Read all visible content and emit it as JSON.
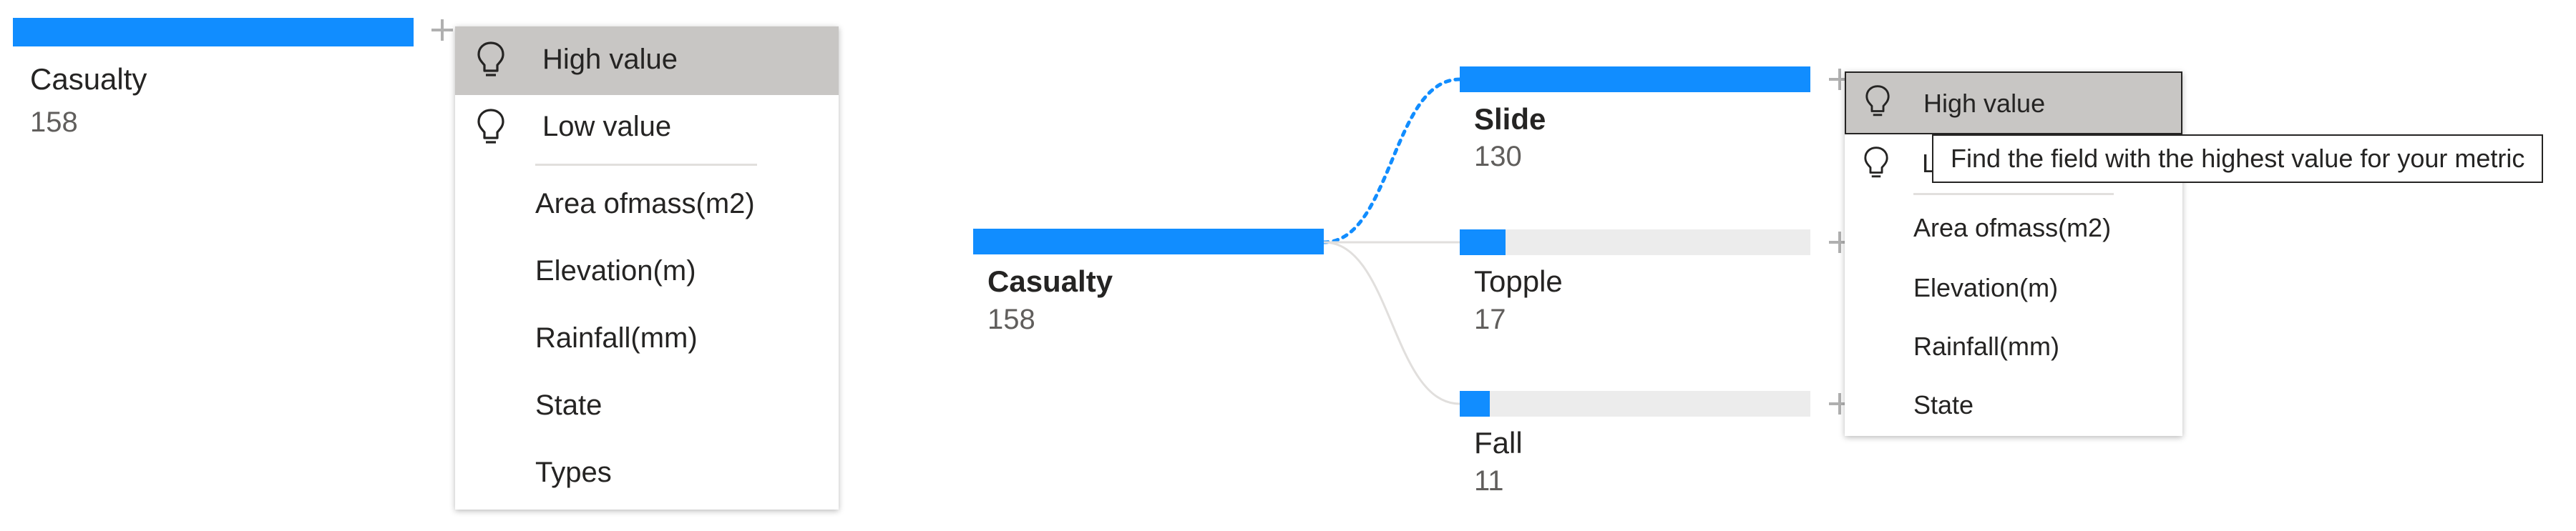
{
  "colors": {
    "accent": "#118dff",
    "track": "#ececec",
    "menu_highlight": "#c8c6c4"
  },
  "left_panel": {
    "root_node": {
      "label": "Casualty",
      "value": "158",
      "fill_fraction": 1.0
    },
    "menu": {
      "items": [
        {
          "label": "High value",
          "icon": "lightbulb-icon",
          "highlighted": true
        },
        {
          "label": "Low value",
          "icon": "lightbulb-icon",
          "highlighted": false
        },
        {
          "label": "Area ofmass(m2)"
        },
        {
          "label": "Elevation(m)"
        },
        {
          "label": "Rainfall(mm)"
        },
        {
          "label": "State"
        },
        {
          "label": "Types"
        }
      ]
    }
  },
  "right_panel": {
    "root_node": {
      "label": "Casualty",
      "value": "158",
      "fill_fraction": 1.0
    },
    "children": [
      {
        "label": "Slide",
        "value": "130",
        "fill_fraction": 1.0,
        "selected": true
      },
      {
        "label": "Topple",
        "value": "17",
        "fill_fraction": 0.131
      },
      {
        "label": "Fall",
        "value": "11",
        "fill_fraction": 0.085
      }
    ],
    "menu": {
      "items": [
        {
          "label": "High value",
          "icon": "lightbulb-icon",
          "highlighted": true
        },
        {
          "label": "L",
          "icon": "lightbulb-icon",
          "highlighted": false
        },
        {
          "label": "Area ofmass(m2)"
        },
        {
          "label": "Elevation(m)"
        },
        {
          "label": "Rainfall(mm)"
        },
        {
          "label": "State"
        }
      ]
    },
    "tooltip": "Find the field with the highest value for your metric"
  }
}
